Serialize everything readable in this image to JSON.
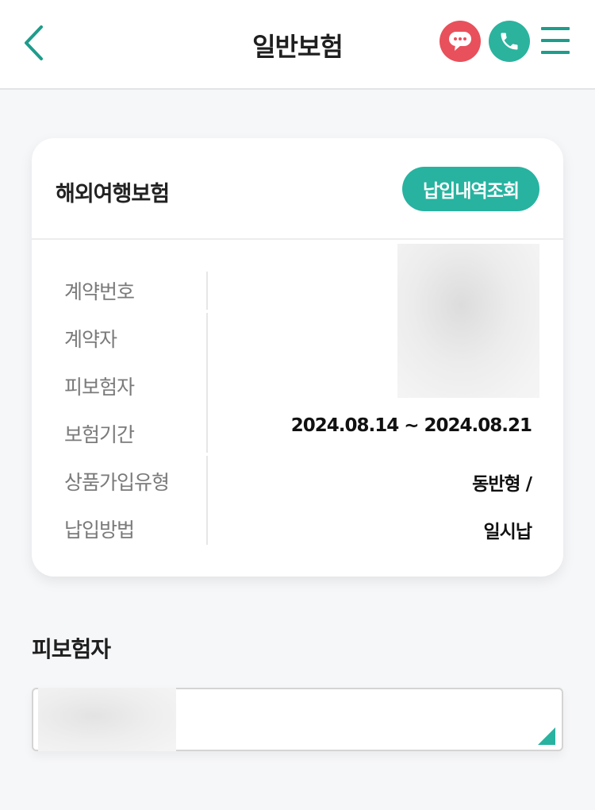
{
  "header": {
    "title": "일반보험",
    "icons": {
      "back": "chevron-left-icon",
      "chat": "chat-bubble-icon",
      "call": "phone-icon",
      "menu": "hamburger-menu-icon"
    }
  },
  "colors": {
    "accent": "#27b3a0",
    "chat": "#e8505b",
    "call": "#2bb39e",
    "background": "#f6f7f9"
  },
  "card": {
    "title": "해외여행보험",
    "pay_history_button": "납입내역조회",
    "labels": {
      "contract_no": "계약번호",
      "contractor": "계약자",
      "insured": "피보험자",
      "period": "보험기간",
      "product_type": "상품가입유형",
      "payment_method": "납입방법"
    },
    "values": {
      "period": "2024.08.14 ~ 2024.08.21",
      "product_type": "동반형 /",
      "payment_method": "일시납"
    }
  },
  "insured_section": {
    "title": "피보험자"
  }
}
